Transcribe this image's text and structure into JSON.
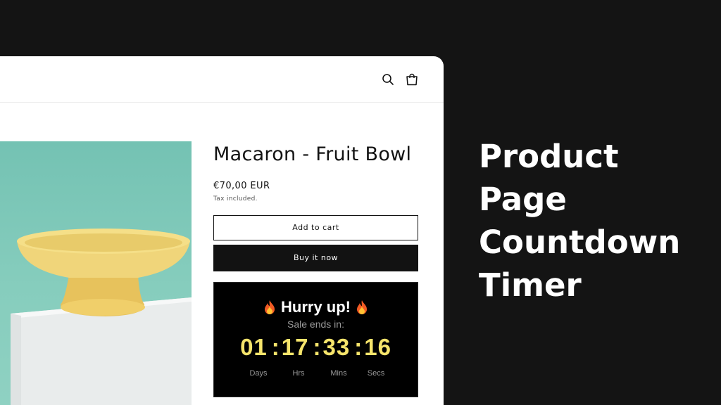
{
  "headline": {
    "lines": [
      "Product",
      "Page",
      "Countdown",
      "Timer"
    ]
  },
  "header": {
    "search_icon": "search-icon",
    "cart_icon": "cart-icon"
  },
  "product": {
    "title": "Macaron - Fruit Bowl",
    "price": "€70,00 EUR",
    "tax_note": "Tax included.",
    "add_to_cart_label": "Add to cart",
    "buy_now_label": "Buy it now"
  },
  "countdown": {
    "heading": "Hurry up!",
    "heading_icon": "fire-icon",
    "subheading": "Sale ends in:",
    "days": "01",
    "hours": "17",
    "minutes": "33",
    "seconds": "16",
    "separator": ":",
    "labels": {
      "days": "Days",
      "hours": "Hrs",
      "minutes": "Mins",
      "seconds": "Secs"
    },
    "digit_color": "#f6e46b"
  },
  "colors": {
    "page_background": "#141414",
    "card_background": "#ffffff",
    "button_dark": "#121212",
    "image_background": "#7fc8b9",
    "bowl": "#f2d97a"
  }
}
